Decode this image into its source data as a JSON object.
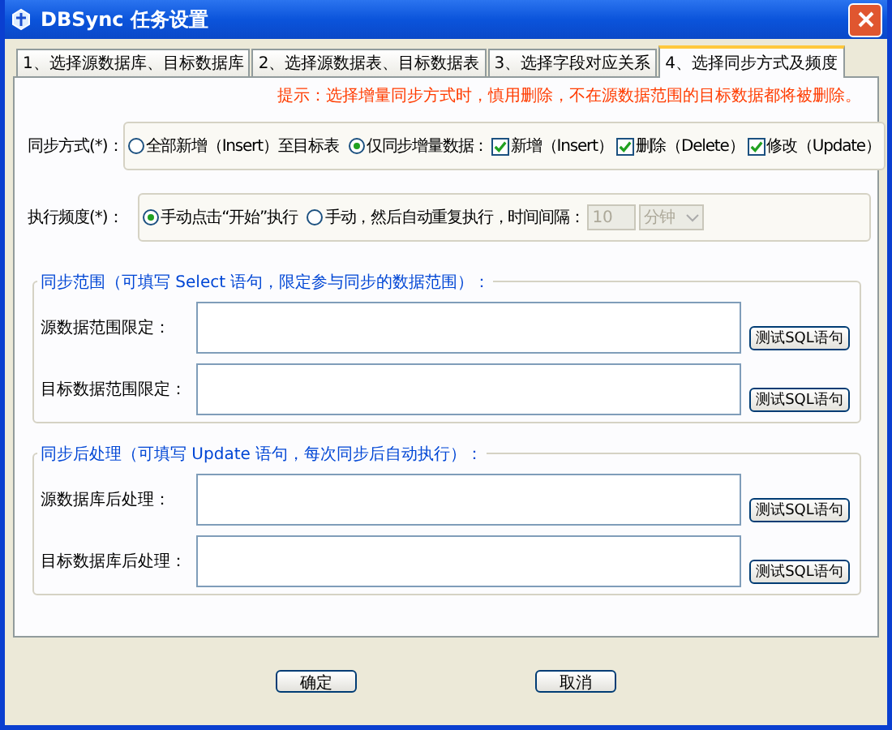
{
  "window": {
    "title": "DBSync 任务设置"
  },
  "tabs": [
    {
      "label": "1、选择源数据库、目标数据库",
      "selected": false
    },
    {
      "label": "2、选择源数据表、目标数据表",
      "selected": false
    },
    {
      "label": "3、选择字段对应关系",
      "selected": false
    },
    {
      "label": "4、选择同步方式及频度",
      "selected": true
    }
  ],
  "hint": "提示：选择增量同步方式时，慎用删除，不在源数据范围的目标数据都将被删除。",
  "sync_mode": {
    "label": "同步方式(*)：",
    "options": [
      {
        "label": "全部新增（Insert）至目标表",
        "selected": false
      },
      {
        "label": "仅同步增量数据：",
        "selected": true
      }
    ],
    "checks": [
      {
        "label": "新增（Insert）",
        "checked": true
      },
      {
        "label": "删除（Delete）",
        "checked": true
      },
      {
        "label": "修改（Update）",
        "checked": true
      }
    ]
  },
  "frequency": {
    "label": "执行频度(*)：",
    "options": [
      {
        "label": "手动点击“开始”执行",
        "selected": true
      },
      {
        "label": "手动，然后自动重复执行，时间间隔：",
        "selected": false
      }
    ],
    "interval": {
      "value": "10",
      "disabled": true
    },
    "unit": {
      "value": "分钟",
      "disabled": true
    }
  },
  "groups": [
    {
      "title": "同步范围（可填写 Select 语句，限定参与同步的数据范围）：",
      "rows": [
        {
          "label": "源数据范围限定：",
          "button": "测试SQL语句"
        },
        {
          "label": "目标数据范围限定：",
          "button": "测试SQL语句"
        }
      ]
    },
    {
      "title": "同步后处理（可填写 Update 语句，每次同步后自动执行）：",
      "rows": [
        {
          "label": "源数据库后处理：",
          "button": "测试SQL语句"
        },
        {
          "label": "目标数据库后处理：",
          "button": "测试SQL语句"
        }
      ]
    }
  ],
  "buttons": [
    "确定",
    "取消"
  ]
}
